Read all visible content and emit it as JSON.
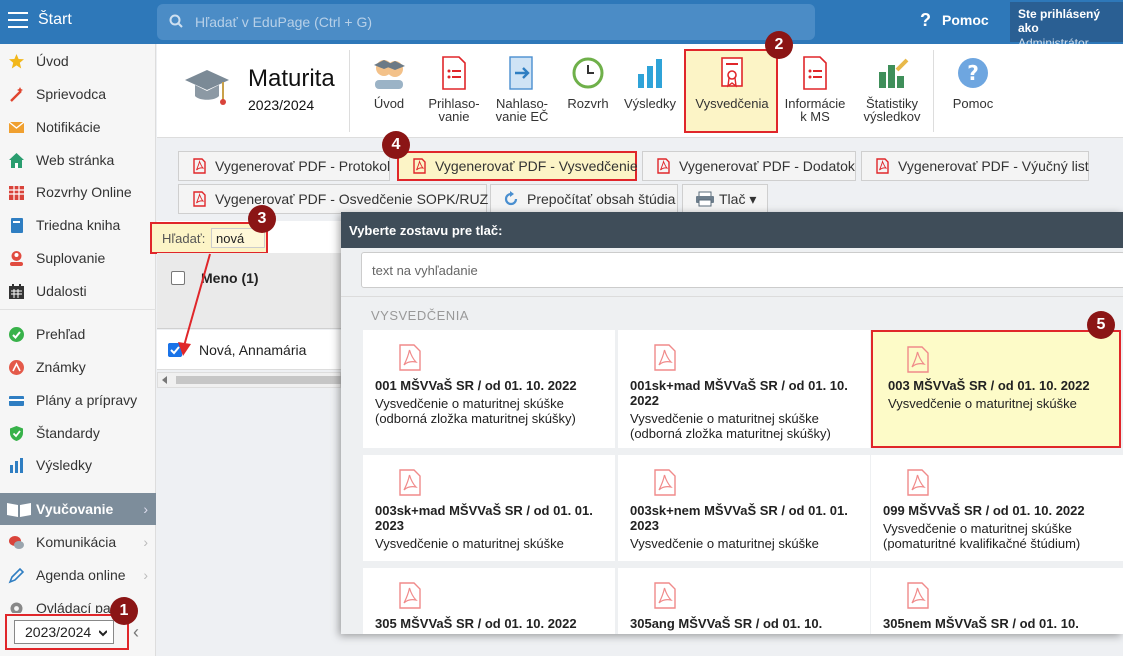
{
  "topbar": {
    "start": "Štart",
    "search_placeholder": "Hľadať v EduPage (Ctrl + G)",
    "help_icon": "?",
    "help": "Pomoc",
    "logged_line1": "Ste prihlásený ako",
    "logged_line2": "Administrátor"
  },
  "sidebar": {
    "items": [
      {
        "label": "Úvod",
        "icon": "star-icon",
        "color": "#f2b71a"
      },
      {
        "label": "Sprievodca",
        "icon": "wand-icon",
        "color": "#e0452f"
      },
      {
        "label": "Notifikácie",
        "icon": "envelope-icon",
        "color": "#f0a030"
      },
      {
        "label": "Web stránka",
        "icon": "home-icon",
        "color": "#2a9d6f"
      },
      {
        "label": "Rozvrhy Online",
        "icon": "grid-icon",
        "color": "#d9433a"
      },
      {
        "label": "Triedna kniha",
        "icon": "book-icon",
        "color": "#2f7ec2"
      },
      {
        "label": "Suplovanie",
        "icon": "person-icon",
        "color": "#e14b3f"
      },
      {
        "label": "Udalosti",
        "icon": "calendar-icon",
        "color": "#333333"
      },
      {
        "label": "Prehľad",
        "icon": "check-circle-icon",
        "color": "#38b24a"
      },
      {
        "label": "Známky",
        "icon": "grades-icon",
        "color": "#e45a4a"
      },
      {
        "label": "Plány a prípravy",
        "icon": "plan-icon",
        "color": "#2f7ec2"
      },
      {
        "label": "Štandardy",
        "icon": "shield-icon",
        "color": "#38b24a"
      },
      {
        "label": "Výsledky",
        "icon": "bar-chart-icon",
        "color": "#2f7ec2"
      }
    ],
    "vyucovanie": "Vyučovanie",
    "bottom_items": [
      {
        "label": "Komunikácia",
        "icon": "chat-icon",
        "color": "#d9433a"
      },
      {
        "label": "Agenda online",
        "icon": "pen-icon",
        "color": "#2f7ec2"
      },
      {
        "label": "Ovládací panel",
        "icon": "gear-icon",
        "color": "#888888"
      }
    ],
    "year": "2023/2024"
  },
  "module": {
    "title": "Maturita",
    "year": "2023/2024",
    "tools": [
      {
        "line1": "Úvod",
        "line2": ""
      },
      {
        "line1": "Prihlaso-",
        "line2": "vanie"
      },
      {
        "line1": "Nahlaso-",
        "line2": "vanie EČ"
      },
      {
        "line1": "Rozvrh",
        "line2": ""
      },
      {
        "line1": "Výsledky",
        "line2": ""
      },
      {
        "line1": "Vysvedčenia",
        "line2": ""
      },
      {
        "line1": "Informácie",
        "line2": "k MS"
      },
      {
        "line1": "Štatistiky",
        "line2": "výsledkov"
      },
      {
        "line1": "Pomoc",
        "line2": ""
      }
    ]
  },
  "buttons": {
    "protokol": "Vygenerovať PDF - Protokol",
    "vysvedcenie": "Vygenerovať PDF - Vysvedčenie",
    "dodatok": "Vygenerovať PDF - Dodatok",
    "vyucny": "Vygenerovať PDF - Výučný list",
    "osvedcenie": "Vygenerovať PDF - Osvedčenie SOPK/RUZ",
    "prepocitat": "Prepočítať obsah štúdia",
    "tlac": "Tlač ▾"
  },
  "table": {
    "search_label": "Hľadať:",
    "search_value": "nová",
    "header": "Meno (1)",
    "rows": [
      "Nová, Annamária"
    ]
  },
  "dialog": {
    "title": "Vyberte zostavu pre tlač:",
    "search_placeholder": "text na vyhľadanie",
    "section": "VYSVEDČENIA",
    "cards": [
      {
        "code": "001 MŠVVaŠ SR / od 01. 10. 2022",
        "desc": "Vysvedčenie o maturitnej skúške (odborná zložka maturitnej skúšky)"
      },
      {
        "code": "001sk+mad MŠVVaŠ SR / od 01. 10. 2022",
        "desc": "Vysvedčenie o maturitnej skúške (odborná zložka maturitnej skúšky)"
      },
      {
        "code": "003 MŠVVaŠ SR / od 01. 10. 2022",
        "desc": "Vysvedčenie o maturitnej skúške"
      },
      {
        "code": "003sk+mad MŠVVaŠ SR / od 01. 01. 2023",
        "desc": "Vysvedčenie o maturitnej skúške"
      },
      {
        "code": "003sk+nem MŠVVaŠ SR / od 01. 01. 2023",
        "desc": "Vysvedčenie o maturitnej skúške"
      },
      {
        "code": "099 MŠVVaŠ SR / od 01. 10. 2022",
        "desc": "Vysvedčenie o maturitnej skúške (pomaturitné kvalifikačné štúdium)"
      },
      {
        "code": "305 MŠVVaŠ SR / od 01. 10. 2022",
        "desc": ""
      },
      {
        "code": "305ang MŠVVaŠ SR / od 01. 10.",
        "desc": ""
      },
      {
        "code": "305nem MŠVVaŠ SR / od 01. 10.",
        "desc": ""
      }
    ]
  },
  "steps": [
    "1",
    "2",
    "3",
    "4",
    "5"
  ],
  "colors": {
    "accent": "#2e78b9",
    "highlight": "#fcf4c6",
    "marker": "#e0262a",
    "step_badge": "#8b1515"
  }
}
